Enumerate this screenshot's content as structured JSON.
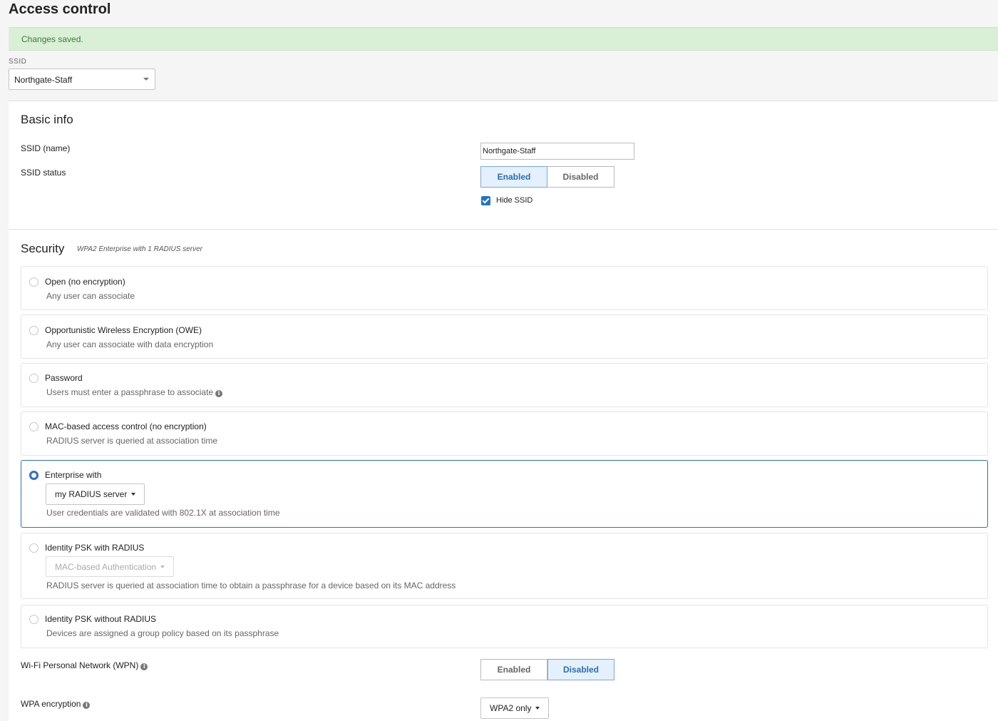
{
  "page": {
    "title": "Access control"
  },
  "alert": {
    "message": "Changes saved."
  },
  "ssid_selector": {
    "label": "SSID",
    "value": "Northgate-Staff"
  },
  "basic_info": {
    "heading": "Basic info",
    "ssid_name_label": "SSID (name)",
    "ssid_name_value": "Northgate-Staff",
    "ssid_status_label": "SSID status",
    "status_enabled": "Enabled",
    "status_disabled": "Disabled",
    "status_selected": "Enabled",
    "hide_ssid_label": "Hide SSID",
    "hide_ssid_checked": true
  },
  "security": {
    "heading": "Security",
    "summary": "WPA2 Enterprise with 1 RADIUS server",
    "options": [
      {
        "title": "Open (no encryption)",
        "desc": "Any user can associate"
      },
      {
        "title": "Opportunistic Wireless Encryption (OWE)",
        "desc": "Any user can associate with data encryption"
      },
      {
        "title": "Password",
        "desc": "Users must enter a passphrase to associate"
      },
      {
        "title": "MAC-based access control (no encryption)",
        "desc": "RADIUS server is queried at association time"
      },
      {
        "title": "Enterprise with",
        "dropdown": "my RADIUS server",
        "desc": "User credentials are validated with 802.1X at association time"
      },
      {
        "title": "Identity PSK with RADIUS",
        "dropdown": "MAC-based Authentication",
        "desc": "RADIUS server is queried at association time to obtain a passphrase for a device based on its MAC address"
      },
      {
        "title": "Identity PSK without RADIUS",
        "desc": "Devices are assigned a group policy based on its passphrase"
      }
    ],
    "selected_option": "Enterprise with"
  },
  "wpn": {
    "label": "Wi-Fi Personal Network (WPN)",
    "enabled": "Enabled",
    "disabled": "Disabled",
    "selected": "Disabled"
  },
  "wpa_encryption": {
    "label": "WPA encryption",
    "value": "WPA2 only"
  },
  "colors": {
    "accent": "#2c6fc9",
    "alert_bg": "#d9f0d6",
    "alert_text": "#3c7a3a",
    "selected_border": "#2f6fad"
  },
  "icons": {
    "info": "info-circle-icon",
    "caret": "caret-down-icon",
    "check": "checkmark-icon"
  }
}
